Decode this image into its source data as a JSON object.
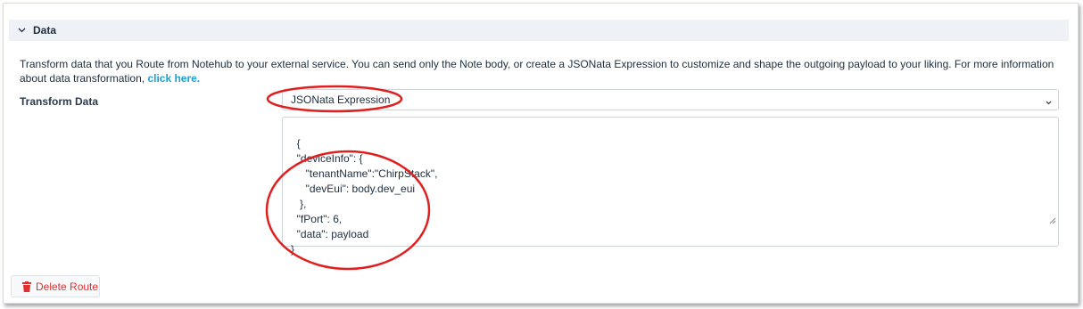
{
  "section": {
    "title": "Data",
    "description": "Transform data that you Route from Notehub to your external service. You can send only the Note body, or create a JSONata Expression to customize and shape the outgoing payload to your liking. For more information about data transformation,",
    "link_text": "click here."
  },
  "transform": {
    "label": "Transform Data",
    "selected": "JSONata Expression",
    "expression": "{\n  \"deviceInfo\": {\n     \"tenantName\":\"ChirpStack\",\n     \"devEui\": body.dev_eui\n   },\n  \"fPort\": 6,\n  \"data\": payload\n}"
  },
  "actions": {
    "delete_label": "Delete Route"
  },
  "colors": {
    "accent_link": "#1aa3d6",
    "danger": "#e03131",
    "annotation": "#e02020",
    "header_bg": "#eef1f5"
  }
}
